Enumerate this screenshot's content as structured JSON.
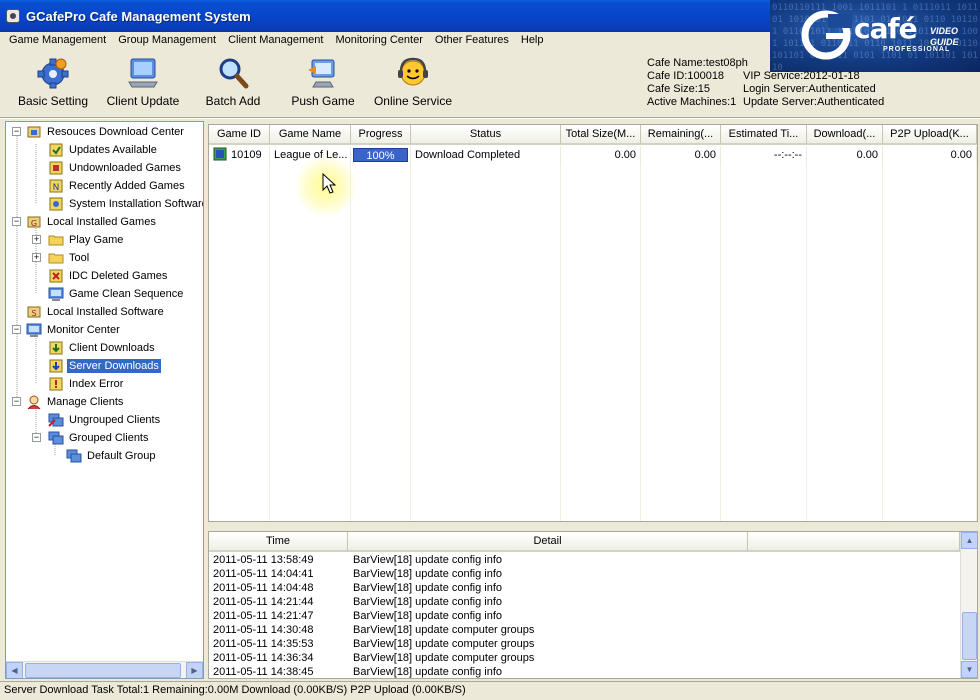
{
  "window": {
    "title": "GCafePro Cafe Management System"
  },
  "menu": [
    "Game Management",
    "Group Management",
    "Client Management",
    "Monitoring Center",
    "Other Features",
    "Help"
  ],
  "brand": {
    "name": "café",
    "sub": "PROFESSIONAL",
    "guide_line1": "VIDEO",
    "guide_line2": "GUIDE",
    "bits": "0110110111 1001 1011101 1 0111011 101101 1010 01 101 1101 01 1011 0110 101101 0110 1011 1011101 0110111011 101 1001 101101 0110111 0110 1011 101101 0110 101101 01 1011 0101 1101 01 101101 10110"
  },
  "toolbar": {
    "buttons": [
      {
        "label": "Basic Setting",
        "icon": "gear-icon"
      },
      {
        "label": "Client Update",
        "icon": "monitor-icon"
      },
      {
        "label": "Batch Add",
        "icon": "magnifier-icon"
      },
      {
        "label": "Push Game",
        "icon": "push-game-icon"
      },
      {
        "label": "Online Service",
        "icon": "headset-icon"
      }
    ]
  },
  "info": {
    "cafe_name": "Cafe Name:test08ph",
    "cafe_id": "Cafe ID:100018",
    "vip_service": "VIP Service:2012-01-18",
    "cafe_size": "Cafe Size:15",
    "login_server": "Login Server:Authenticated",
    "active_machines": "Active Machines:1",
    "update_server": "Update Server:Authenticated"
  },
  "tree": {
    "nodes": [
      {
        "label": "Resouces Download Center"
      },
      {
        "label": "Updates Available"
      },
      {
        "label": "Undownloaded Games"
      },
      {
        "label": "Recently Added Games"
      },
      {
        "label": "System Installation Software"
      },
      {
        "label": "Local Installed Games"
      },
      {
        "label": "Play Game"
      },
      {
        "label": "Tool"
      },
      {
        "label": "IDC Deleted Games"
      },
      {
        "label": "Game Clean Sequence"
      },
      {
        "label": "Local Installed Software"
      },
      {
        "label": "Monitor Center"
      },
      {
        "label": "Client Downloads"
      },
      {
        "label": "Server Downloads"
      },
      {
        "label": "Index Error"
      },
      {
        "label": "Manage Clients"
      },
      {
        "label": "Ungrouped Clients"
      },
      {
        "label": "Grouped Clients"
      },
      {
        "label": "Default Group"
      }
    ]
  },
  "grid": {
    "columns": [
      "Game ID",
      "Game Name",
      "Progress",
      "Status",
      "Total Size(M...",
      "Remaining(...",
      "Estimated Ti...",
      "Download(...",
      "P2P Upload(K..."
    ],
    "rows": [
      {
        "game_id": "10109",
        "game_name": "League of Le...",
        "progress_label": "100%",
        "progress": 1.0,
        "status": "Download Completed",
        "total_size": "0.00",
        "remaining": "0.00",
        "estimated": "--:--:--",
        "download": "0.00",
        "p2p_upload": "0.00"
      }
    ]
  },
  "log": {
    "columns": [
      "Time",
      "Detail"
    ],
    "rows": [
      {
        "time": "2011-05-11 13:58:49",
        "detail": "BarView[18] update config info"
      },
      {
        "time": "2011-05-11 14:04:41",
        "detail": "BarView[18] update config info"
      },
      {
        "time": "2011-05-11 14:04:48",
        "detail": "BarView[18] update config info"
      },
      {
        "time": "2011-05-11 14:21:44",
        "detail": "BarView[18] update config info"
      },
      {
        "time": "2011-05-11 14:21:47",
        "detail": "BarView[18] update config info"
      },
      {
        "time": "2011-05-11 14:30:48",
        "detail": "BarView[18] update computer groups"
      },
      {
        "time": "2011-05-11 14:35:53",
        "detail": "BarView[18] update computer groups"
      },
      {
        "time": "2011-05-11 14:36:34",
        "detail": "BarView[18] update computer groups"
      },
      {
        "time": "2011-05-11 14:38:45",
        "detail": "BarView[18] update config info"
      }
    ]
  },
  "status_bar": "Server Download Task Total:1 Remaining:0.00M Download (0.00KB/S) P2P Upload (0.00KB/S)",
  "colors": {
    "titlebar": "#0a4fd0",
    "selection": "#316ac5",
    "progress": "#3a64c8",
    "brand_bg": "#123a80"
  }
}
